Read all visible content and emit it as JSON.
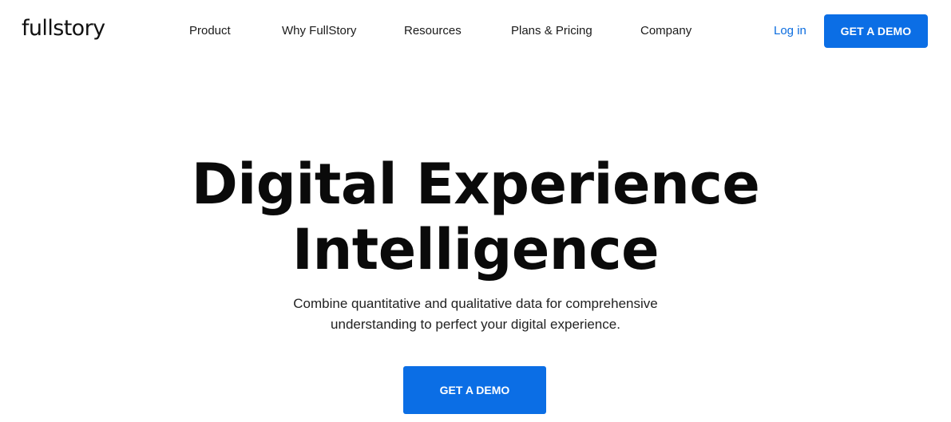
{
  "header": {
    "logo": "fullstory",
    "nav": [
      "Product",
      "Why FullStory",
      "Resources",
      "Plans & Pricing",
      "Company"
    ],
    "login": "Log in",
    "cta": "GET A DEMO"
  },
  "hero": {
    "title_line1": "Digital Experience",
    "title_line2": "Intelligence",
    "subtitle_line1": "Combine quantitative and qualitative data for comprehensive",
    "subtitle_line2": "understanding to perfect your digital experience.",
    "cta": "GET A DEMO"
  },
  "colors": {
    "accent": "#0b6ee5",
    "link": "#0a6cdf",
    "text": "#111111",
    "background": "#ffffff"
  }
}
